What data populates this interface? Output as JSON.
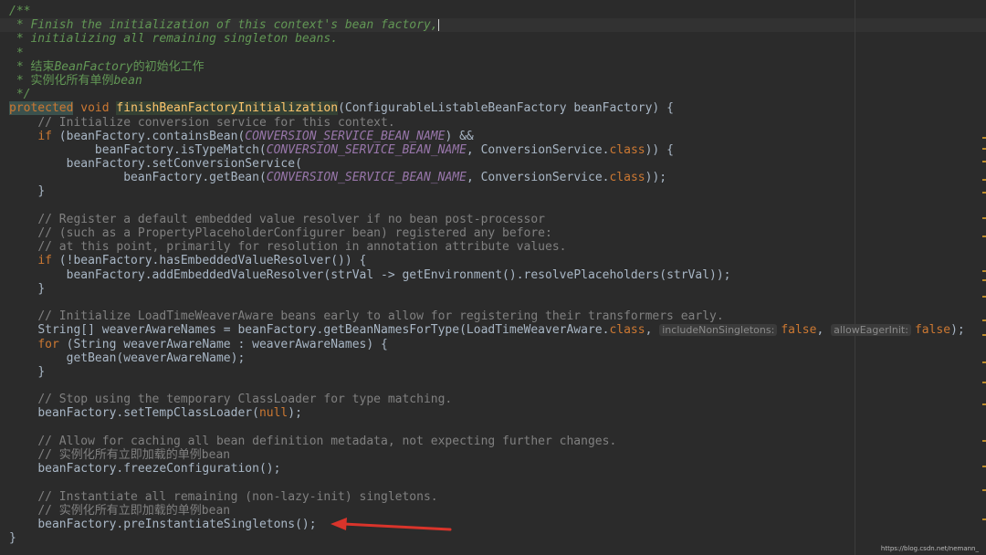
{
  "code": {
    "doc_open": "/**",
    "doc_line1": " * Finish the initialization of this context's bean factory,",
    "doc_line2": " * initializing all remaining singleton beans.",
    "doc_star": " *",
    "doc_zh1_prefix": " * 结束",
    "doc_zh1_italic": "BeanFactory",
    "doc_zh1_suffix": "的初始化工作",
    "doc_zh2_prefix": " * 实例化所有单例",
    "doc_zh2_italic": "bean",
    "doc_close": " */",
    "kw_protected": "protected",
    "kw_void": "void",
    "method_name": "finishBeanFactoryInitialization",
    "method_params": "(ConfigurableListableBeanFactory beanFactory) {",
    "cmt_init_conv": "// Initialize conversion service for this context.",
    "kw_if": "if",
    "contains_bean_pre": " (beanFactory.containsBean(",
    "const_conv": "CONVERSION_SERVICE_BEAN_NAME",
    "contains_bean_post": ") &&",
    "is_type_match_pre": "beanFactory.isTypeMatch(",
    "conv_service": ", ConversionService.",
    "kw_class": "class",
    "is_type_match_post": ")) {",
    "set_conv_service": "beanFactory.setConversionService(",
    "get_bean_pre": "beanFactory.getBean(",
    "get_bean_post": "));",
    "close_brace": "}",
    "cmt_register1": "// Register a default embedded value resolver if no bean post-processor",
    "cmt_register2": "// (such as a PropertyPlaceholderConfigurer bean) registered any before:",
    "cmt_register3": "// at this point, primarily for resolution in annotation attribute values.",
    "has_resolver": " (!beanFactory.hasEmbeddedValueResolver()) {",
    "add_resolver": "beanFactory.addEmbeddedValueResolver(strVal -> getEnvironment().resolvePlaceholders(strVal));",
    "cmt_ltw": "// Initialize LoadTimeWeaverAware beans early to allow for registering their transformers early.",
    "weaver_names_pre": "String[] weaverAwareNames = beanFactory.getBeanNamesForType(LoadTimeWeaverAware.",
    "hint_non_singletons": "includeNonSingletons:",
    "hint_eager_init": "allowEagerInit:",
    "kw_false": "false",
    "kw_for": "for",
    "for_body": " (String weaverAwareName : weaverAwareNames) {",
    "get_bean_weaver": "getBean(weaverAwareName);",
    "cmt_stop_temp": "// Stop using the temporary ClassLoader for type matching.",
    "set_temp_cl_pre": "beanFactory.setTempClassLoader(",
    "kw_null": "null",
    "set_temp_cl_post": ");",
    "cmt_allow_cache": "// Allow for caching all bean definition metadata, not expecting further changes.",
    "cmt_zh_instantiate": "// 实例化所有立即加载的单例bean",
    "freeze_config": "beanFactory.freezeConfiguration();",
    "cmt_instantiate_all": "// Instantiate all remaining (non-lazy-init) singletons.",
    "pre_instantiate": "beanFactory.preInstantiateSingletons();"
  },
  "watermark": "https://blog.csdn.net/nemann_",
  "colors": {
    "background": "#2b2b2b",
    "text": "#a9b7c6",
    "keyword": "#cc7832",
    "comment": "#808080",
    "doc_comment": "#629755",
    "method_decl": "#ffc66d",
    "static_field": "#9876aa",
    "arrow": "#d9342b"
  }
}
